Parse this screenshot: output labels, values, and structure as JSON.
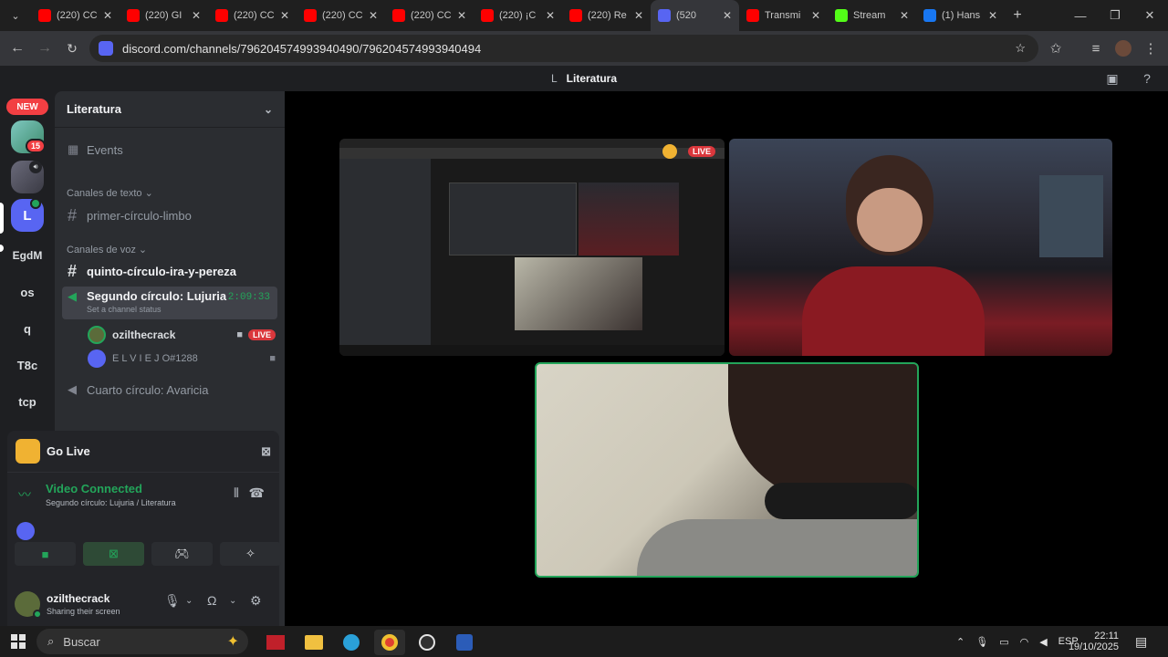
{
  "browser": {
    "tabs": [
      {
        "label": "(220) CC",
        "fav": "yt"
      },
      {
        "label": "(220) GI",
        "fav": "yt"
      },
      {
        "label": "(220) CC",
        "fav": "yt"
      },
      {
        "label": "(220) CC",
        "fav": "yt"
      },
      {
        "label": "(220) CC",
        "fav": "yt"
      },
      {
        "label": "(220) ¡C",
        "fav": "yt"
      },
      {
        "label": "(220) Re",
        "fav": "yt"
      },
      {
        "label": "(520",
        "fav": "discord",
        "active": true
      },
      {
        "label": "Transmi",
        "fav": "yt"
      },
      {
        "label": "Stream",
        "fav": "kick"
      },
      {
        "label": "(1) Hans",
        "fav": "fb"
      }
    ],
    "url": "discord.com/channels/796204574993940490/796204574993940494"
  },
  "topbar": {
    "guild_initial": "L",
    "title": "Literatura"
  },
  "guilds": {
    "new_label": "NEW",
    "badge_count": "15",
    "active_initial": "L",
    "items": [
      "EgdM",
      "os",
      "q",
      "T8c",
      "tcp"
    ]
  },
  "sidebar": {
    "server_name": "Literatura",
    "events_label": "Events",
    "text_category": "Canales de texto",
    "text_channel": "primer-círculo-limbo",
    "voice_category": "Canales de voz",
    "channel_quinto": "quinto-círculo-ira-y-pereza",
    "active_voice": {
      "name": "Segundo círculo: Lujuria",
      "timer": "2:09:33",
      "status": "Set a channel status"
    },
    "members": [
      {
        "name": "ozilthecrack",
        "live": "LIVE"
      },
      {
        "name": "E L V I E J O#1288"
      }
    ],
    "channel_cuarto": "Cuarto círculo: Avaricia"
  },
  "panel": {
    "golive_label": "Go Live",
    "vc_title": "Video Connected",
    "vc_sub": "Segundo círculo: Lujuria / Literatura"
  },
  "user": {
    "name": "ozilthecrack",
    "status": "Sharing their screen"
  },
  "taskbar": {
    "search_placeholder": "Buscar",
    "lang": "ESP",
    "time": "22:11",
    "date": "19/10/2025"
  },
  "colors": {
    "accent": "#5865f2",
    "green": "#23a55a",
    "red": "#da373c"
  }
}
